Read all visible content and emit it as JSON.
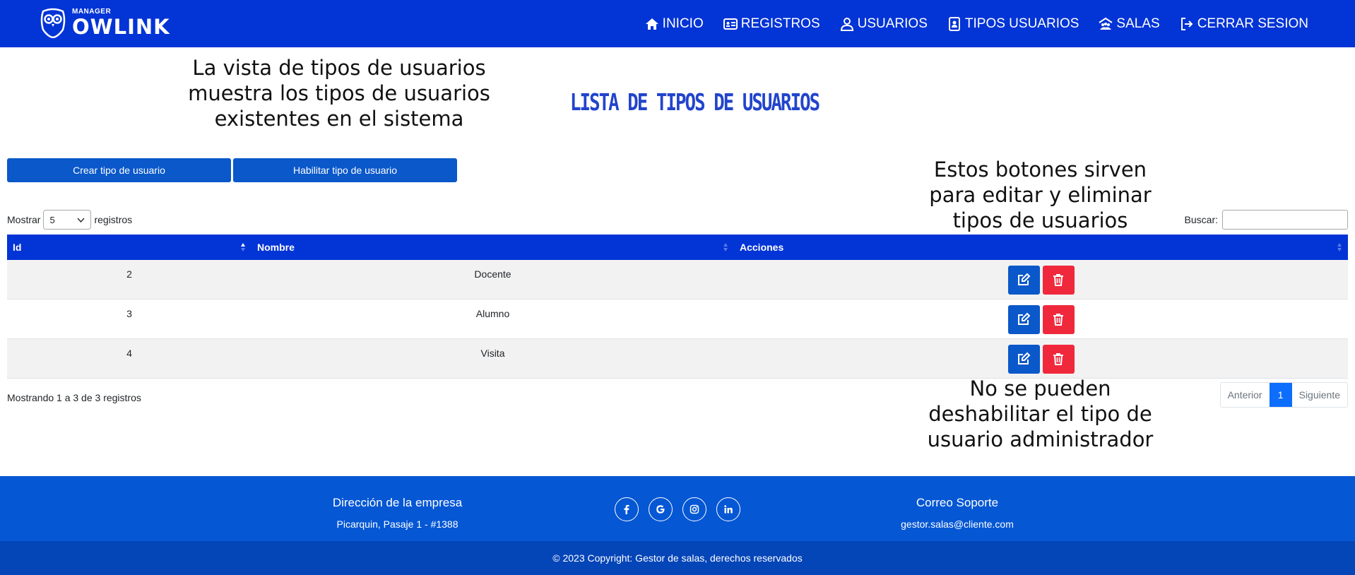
{
  "brand": {
    "small": "MANAGER",
    "name": "OWLINK",
    "icon": "owl-logo-icon"
  },
  "nav": [
    {
      "label": "INICIO",
      "icon": "home-icon"
    },
    {
      "label": "REGISTROS",
      "icon": "id-card-icon"
    },
    {
      "label": "USUARIOS",
      "icon": "user-icon"
    },
    {
      "label": "TIPOS USUARIOS",
      "icon": "contact-card-icon"
    },
    {
      "label": "SALAS",
      "icon": "people-roof-icon"
    },
    {
      "label": "CERRAR SESION",
      "icon": "sign-out-icon"
    }
  ],
  "annotations": {
    "top_left": "La vista de tipos de usuarios muestra los tipos de usuarios existentes en el sistema",
    "buttons": "Estos botones sirven para editar y eliminar tipos de usuarios",
    "admin": "No se pueden deshabilitar el tipo de usuario administrador"
  },
  "page": {
    "title": "LISTA DE TIPOS DE USUARIOS"
  },
  "actions": {
    "create": "Crear tipo de usuario",
    "enable": "Habilitar tipo de usuario"
  },
  "table_controls": {
    "show_label": "Mostrar",
    "page_size": "5",
    "records_label": "registros",
    "search_label": "Buscar:",
    "search_value": ""
  },
  "table": {
    "headers": [
      "Id",
      "Nombre",
      "Acciones"
    ],
    "rows": [
      {
        "id": "2",
        "nombre": "Docente"
      },
      {
        "id": "3",
        "nombre": "Alumno"
      },
      {
        "id": "4",
        "nombre": "Visita"
      }
    ],
    "info": "Mostrando 1 a 3 de 3 registros"
  },
  "pagination": {
    "prev": "Anterior",
    "current": "1",
    "next": "Siguiente"
  },
  "footer": {
    "address_title": "Dirección de la empresa",
    "address": "Picarquin, Pasaje 1 - #1388",
    "mail_title": "Correo Soporte",
    "mail": "gestor.salas@cliente.com",
    "socials": [
      "facebook-icon",
      "google-icon",
      "instagram-icon",
      "linkedin-icon"
    ],
    "copyright": "© 2023 Copyright: Gestor de salas, derechos reservados"
  },
  "colors": {
    "nav": "#0334d6",
    "primary_btn": "#0a58ca",
    "danger_btn": "#f0283c",
    "footer": "#0557d4",
    "footer_bottom": "#0445b8",
    "title": "#2244cc"
  }
}
